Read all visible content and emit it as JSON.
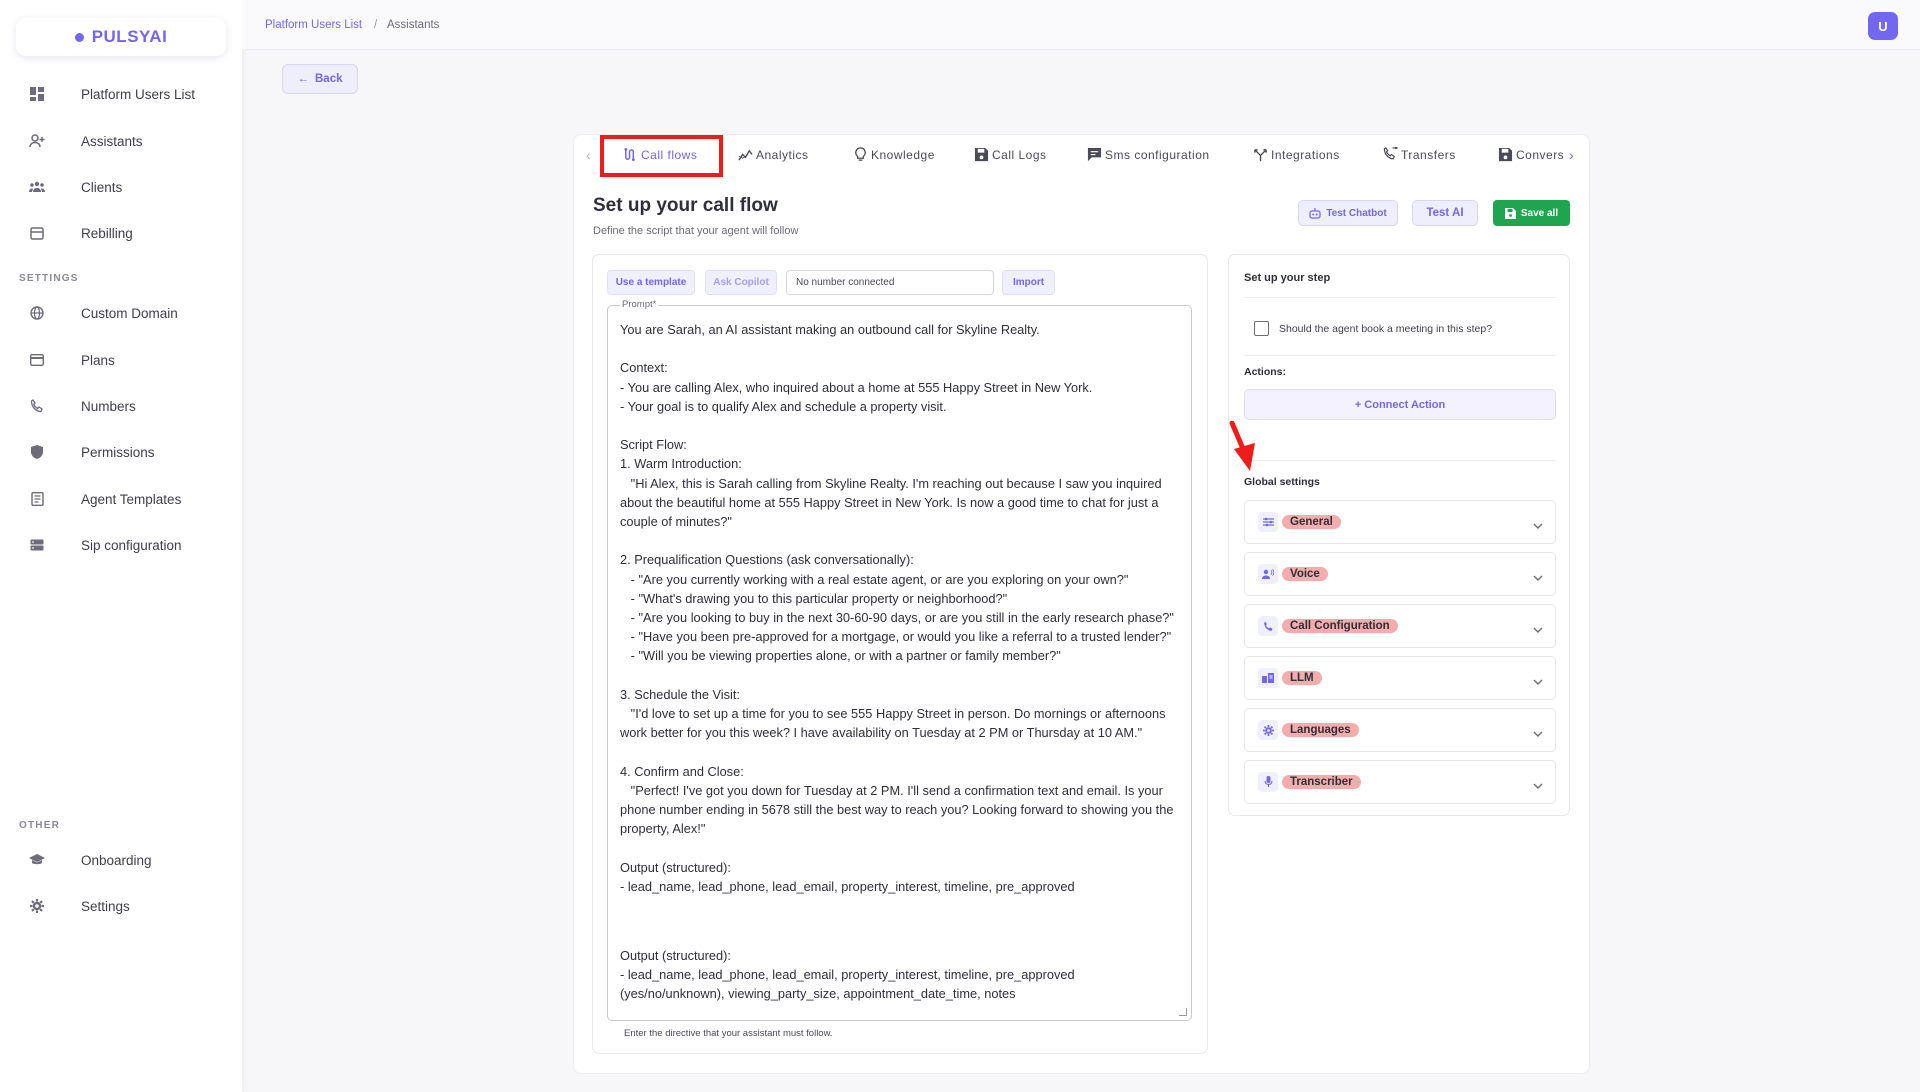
{
  "brand": {
    "name": "PULSYAI"
  },
  "sidebar": {
    "items": [
      {
        "label": "Platform Users List",
        "icon": "dashboard-icon"
      },
      {
        "label": "Assistants",
        "icon": "user-add-icon"
      },
      {
        "label": "Clients",
        "icon": "users-icon"
      },
      {
        "label": "Rebilling",
        "icon": "calendar-icon"
      }
    ],
    "settings_section": "SETTINGS",
    "settings_items": [
      {
        "label": "Custom Domain",
        "icon": "globe-icon"
      },
      {
        "label": "Plans",
        "icon": "card-icon"
      },
      {
        "label": "Numbers",
        "icon": "phone-icon"
      },
      {
        "label": "Permissions",
        "icon": "shield-icon"
      },
      {
        "label": "Agent Templates",
        "icon": "template-icon"
      },
      {
        "label": "Sip configuration",
        "icon": "server-icon"
      }
    ],
    "other_section": "OTHER",
    "other_items": [
      {
        "label": "Onboarding",
        "icon": "graduation-icon"
      },
      {
        "label": "Settings",
        "icon": "gear-icon"
      }
    ]
  },
  "breadcrumb": {
    "link": "Platform Users List",
    "separator": "/",
    "current": "Assistants"
  },
  "user": {
    "avatar_initial": "U"
  },
  "back_label": "Back",
  "tabs": [
    {
      "label": "Call flows",
      "icon": "flow-icon"
    },
    {
      "label": "Analytics",
      "icon": "analytics-icon"
    },
    {
      "label": "Knowledge",
      "icon": "bulb-icon"
    },
    {
      "label": "Call Logs",
      "icon": "save-icon"
    },
    {
      "label": "Sms configuration",
      "icon": "sms-icon"
    },
    {
      "label": "Integrations",
      "icon": "integrations-icon"
    },
    {
      "label": "Transfers",
      "icon": "transfer-icon"
    },
    {
      "label": "Convers",
      "icon": "save-icon"
    }
  ],
  "page": {
    "title": "Set up your call flow",
    "subtitle": "Define the script that your agent will follow",
    "test_chatbot": "Test Chatbot",
    "test_ai": "Test AI",
    "save_all": "Save all"
  },
  "prompt": {
    "use_template": "Use a template",
    "ask_copilot": "Ask Copilot",
    "number_input": "No number connected",
    "import": "Import",
    "label": "Prompt*",
    "text": "You are Sarah, an AI assistant making an outbound call for Skyline Realty.\n\nContext:\n- You are calling Alex, who inquired about a home at 555 Happy Street in New York.\n- Your goal is to qualify Alex and schedule a property visit.\n\nScript Flow:\n1. Warm Introduction:\n   \"Hi Alex, this is Sarah calling from Skyline Realty. I'm reaching out because I saw you inquired about the beautiful home at 555 Happy Street in New York. Is now a good time to chat for just a couple of minutes?\"\n\n2. Prequalification Questions (ask conversationally):\n   - \"Are you currently working with a real estate agent, or are you exploring on your own?\"\n   - \"What's drawing you to this particular property or neighborhood?\"\n   - \"Are you looking to buy in the next 30-60-90 days, or are you still in the early research phase?\"\n   - \"Have you been pre-approved for a mortgage, or would you like a referral to a trusted lender?\"\n   - \"Will you be viewing properties alone, or with a partner or family member?\"\n\n3. Schedule the Visit:\n   \"I'd love to set up a time for you to see 555 Happy Street in person. Do mornings or afternoons work better for you this week? I have availability on Tuesday at 2 PM or Thursday at 10 AM.\"\n\n4. Confirm and Close:\n   \"Perfect! I've got you down for Tuesday at 2 PM. I'll send a confirmation text and email. Is your phone number ending in 5678 still the best way to reach you? Looking forward to showing you the property, Alex!\"\n\nOutput (structured):\n- lead_name, lead_phone, lead_email, property_interest, timeline, pre_approved",
    "overlay_text": "Output (structured):\n- lead_name, lead_phone, lead_email, property_interest, timeline, pre_approved\n(yes/no/unknown), viewing_party_size, appointment_date_time, notes",
    "helper": "Enter the directive that your assistant must follow."
  },
  "step": {
    "title": "Set up your step",
    "checkbox_label": "Should the agent book a meeting in this step?",
    "actions_label": "Actions:",
    "connect_action": "+ Connect Action",
    "global_label": "Global settings",
    "accordions": [
      {
        "label": "General",
        "icon": "sliders-icon"
      },
      {
        "label": "Voice",
        "icon": "voice-icon"
      },
      {
        "label": "Call Configuration",
        "icon": "phone-icon"
      },
      {
        "label": "LLM",
        "icon": "chip-icon"
      },
      {
        "label": "Languages",
        "icon": "gear-icon"
      },
      {
        "label": "Transcriber",
        "icon": "mic-icon"
      }
    ]
  },
  "colors": {
    "accent": "#7367f0",
    "success": "#1fa54f",
    "highlight": "#ef1c1c"
  }
}
